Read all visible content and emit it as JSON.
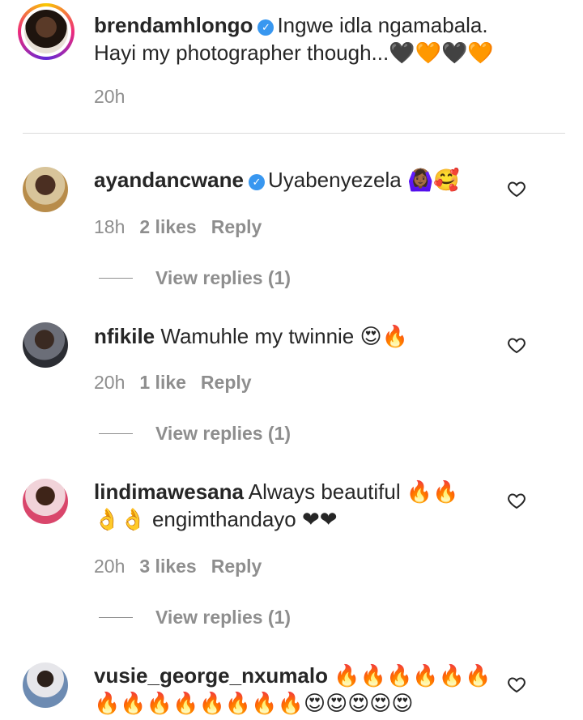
{
  "post": {
    "username": "brendamhlongo",
    "caption_line1": "Ingwe idla ngamabala.",
    "caption_line2": "Hayi my photographer though...🖤🧡🖤🧡",
    "time": "20h"
  },
  "comments": [
    {
      "username": "ayandancwane",
      "verified": true,
      "text_line1": "Uyabenyezela 🙆🏾‍♀️🥰",
      "text_line2": "",
      "time": "18h",
      "likes": "2 likes",
      "reply": "Reply",
      "view_replies": "View replies (1)"
    },
    {
      "username": "nfikile",
      "verified": false,
      "text_line1": "Wamuhle my twinnie 😍🔥",
      "text_line2": "",
      "time": "20h",
      "likes": "1 like",
      "reply": "Reply",
      "view_replies": "View replies (1)"
    },
    {
      "username": "lindimawesana",
      "verified": false,
      "text_line1": "Always beautiful 🔥🔥",
      "text_line2": "👌👌 engimthandayo ❤❤",
      "time": "20h",
      "likes": "3 likes",
      "reply": "Reply",
      "view_replies": "View replies (1)"
    },
    {
      "username": "vusie_george_nxumalo",
      "verified": false,
      "text_line1": "🔥🔥🔥🔥🔥🔥",
      "text_line2": "🔥🔥🔥🔥🔥🔥🔥🔥😍😍😍😍😍",
      "time": "",
      "likes": "",
      "reply": "",
      "view_replies": ""
    }
  ],
  "icons": {
    "verified": "verified-badge-icon",
    "heart": "heart-outline-icon"
  },
  "colors": {
    "text": "#262626",
    "muted": "#8e8e8e",
    "verified": "#3897f0"
  }
}
